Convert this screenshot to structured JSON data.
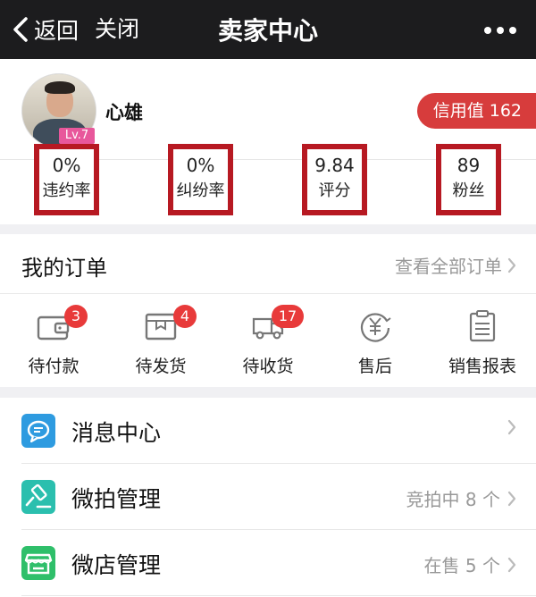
{
  "nav": {
    "back_label": "返回",
    "close_label": "关闭",
    "title": "卖家中心"
  },
  "profile": {
    "username": "心雄",
    "level": "Lv.7",
    "credit": "信用值 162"
  },
  "stats": [
    {
      "value": "0%",
      "label": "违约率"
    },
    {
      "value": "0%",
      "label": "纠纷率"
    },
    {
      "value": "9.84",
      "label": "评分"
    },
    {
      "value": "89",
      "label": "粉丝"
    }
  ],
  "orders": {
    "title": "我的订单",
    "view_all": "查看全部订单",
    "items": [
      {
        "label": "待付款",
        "badge": "3",
        "icon": "wallet-icon"
      },
      {
        "label": "待发货",
        "badge": "4",
        "icon": "package-icon"
      },
      {
        "label": "待收货",
        "badge": "17",
        "icon": "truck-icon"
      },
      {
        "label": "售后",
        "badge": "",
        "icon": "yuan-refund-icon"
      },
      {
        "label": "销售报表",
        "badge": "",
        "icon": "clipboard-icon"
      }
    ]
  },
  "menu": [
    {
      "label": "消息中心",
      "right": "",
      "icon": "message-bubble-icon",
      "color": "#2e9be0"
    },
    {
      "label": "微拍管理",
      "right": "竞拍中 8 个",
      "icon": "auction-hammer-icon",
      "color": "#2bbfae"
    },
    {
      "label": "微店管理",
      "right": "在售 5 个",
      "icon": "store-icon",
      "color": "#2fbf6a"
    }
  ],
  "colors": {
    "accent_red": "#d73c3c",
    "badge_red": "#e83a3a",
    "highlight_frame": "#b71922",
    "level_pink": "#e8579b"
  }
}
